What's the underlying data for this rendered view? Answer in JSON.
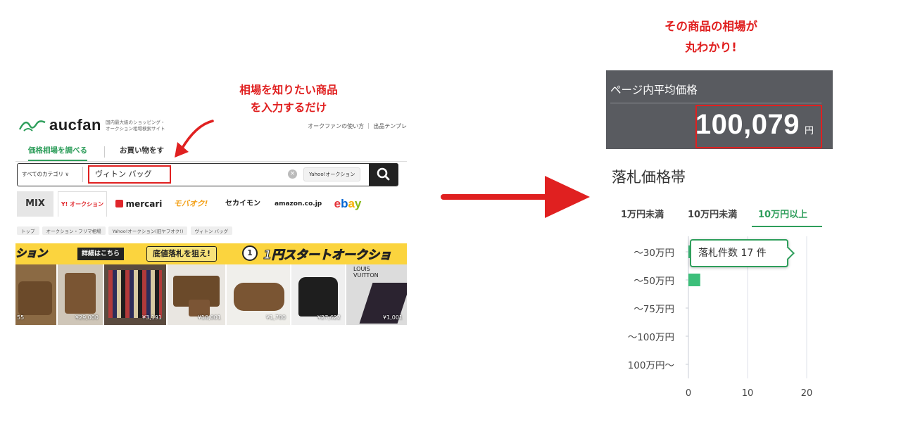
{
  "annotations": {
    "left_line1": "相場を知りたい商品",
    "left_line2": "を入力するだけ",
    "right_line1": "その商品の相場が",
    "right_line2": "丸わかり!"
  },
  "header": {
    "logo": "aucfan",
    "tagline_line1": "国内最大級のショッピング・",
    "tagline_line2": "オークション相場検索サイト",
    "links": "オークファンの使い方 ｜ 出品テンプレ"
  },
  "tabs": [
    {
      "label": "価格相場を調べる"
    },
    {
      "label": "お買い物をす"
    }
  ],
  "search": {
    "category": "すべてのカテゴリ ∨",
    "query": "ヴィトン バッグ",
    "site_chip": "Yahoo!オークション"
  },
  "sites": {
    "mix": "MIX",
    "yahoo": "Y! オークション",
    "mercari": "mercari",
    "mobaoku": "モバオク!",
    "sekaimon": "セカイモン",
    "amazon": "amazon.co.jp",
    "ebay_e": "e",
    "ebay_b": "b",
    "ebay_a": "a",
    "ebay_y": "y"
  },
  "breadcrumbs": [
    "トップ",
    "オークション・フリマ相場",
    "Yahoo!オークション(旧ヤフオク!)",
    "ヴィトン バッグ"
  ],
  "banner": {
    "left": "ション",
    "detail": "詳細はこちら",
    "mid": "底値落札を狙え!",
    "one": "1",
    "right": "1円スタートオークショ"
  },
  "products": [
    {
      "price": "55"
    },
    {
      "price": "¥29,000"
    },
    {
      "price": "¥3,191"
    },
    {
      "price": "¥10,001"
    },
    {
      "price": "¥1,700"
    },
    {
      "price": "¥27,622"
    },
    {
      "price": "¥1,001"
    }
  ],
  "product_brand_line1": "LOUIS",
  "product_brand_line2": "VUITTON",
  "price_box": {
    "label": "ページ内平均価格",
    "value": "100,079",
    "unit": "円"
  },
  "range": {
    "title": "落札価格帯",
    "tabs": [
      "1万円未満",
      "10万円未満",
      "10万円以上"
    ],
    "active_tab": 2,
    "tooltip": "落札件数 17 件"
  },
  "colors": {
    "accent_red": "#e02020",
    "aucfan_green": "#2e9e5b",
    "price_box_bg": "#595b60",
    "bar_green": "#3cbf7a"
  },
  "chart_data": {
    "type": "bar",
    "orientation": "horizontal",
    "categories": [
      "〜30万円",
      "〜50万円",
      "〜75万円",
      "〜100万円",
      "100万円〜"
    ],
    "values": [
      1,
      2,
      0,
      0,
      0
    ],
    "xlim": [
      0,
      20
    ],
    "xticks": [
      "0",
      "10",
      "20"
    ],
    "grid": true,
    "legend": "none"
  }
}
